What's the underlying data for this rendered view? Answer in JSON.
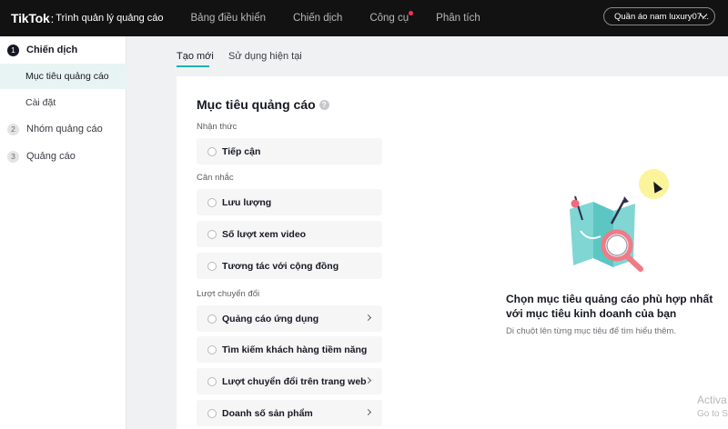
{
  "topbar": {
    "brand": "TikTok",
    "brand_sub": "Trình quản lý quảng cáo",
    "nav": [
      "Bảng điều khiển",
      "Chiến dịch",
      "Công cụ",
      "Phân tích"
    ],
    "account_name": "Quần áo nam luxury07..."
  },
  "sidebar": {
    "steps": [
      {
        "num": "1",
        "label": "Chiến dịch"
      },
      {
        "num": "2",
        "label": "Nhóm quảng cáo"
      },
      {
        "num": "3",
        "label": "Quảng cáo"
      }
    ],
    "substeps": [
      "Mục tiêu quảng cáo",
      "Cài đặt"
    ]
  },
  "tabs": [
    "Tạo mới",
    "Sử dụng hiện tại"
  ],
  "objective": {
    "title": "Mục tiêu quảng cáo",
    "help_icon": "?",
    "categories": [
      {
        "label": "Nhận thức",
        "options": [
          "Tiếp cận"
        ]
      },
      {
        "label": "Cân nhắc",
        "options": [
          "Lưu lượng",
          "Số lượt xem video",
          "Tương tác với cộng đồng"
        ]
      },
      {
        "label": "Lượt chuyển đổi",
        "options": [
          "Quảng cáo ứng dụng",
          "Tìm kiếm khách hàng tiềm năng",
          "Lượt chuyển đổi trên trang web",
          "Doanh số sản phẩm"
        ]
      }
    ]
  },
  "hint": {
    "title": "Chọn mục tiêu quảng cáo phù hợp nhất với mục tiêu kinh doanh của bạn",
    "subtitle": "Di chuột lên từng mục tiêu để tìm hiểu thêm."
  },
  "watermark": {
    "line1": "Activa",
    "line2": "Go to S"
  },
  "colors": {
    "accent": "#16b5b0",
    "topbar": "#121212",
    "notification": "#fe2c55"
  }
}
